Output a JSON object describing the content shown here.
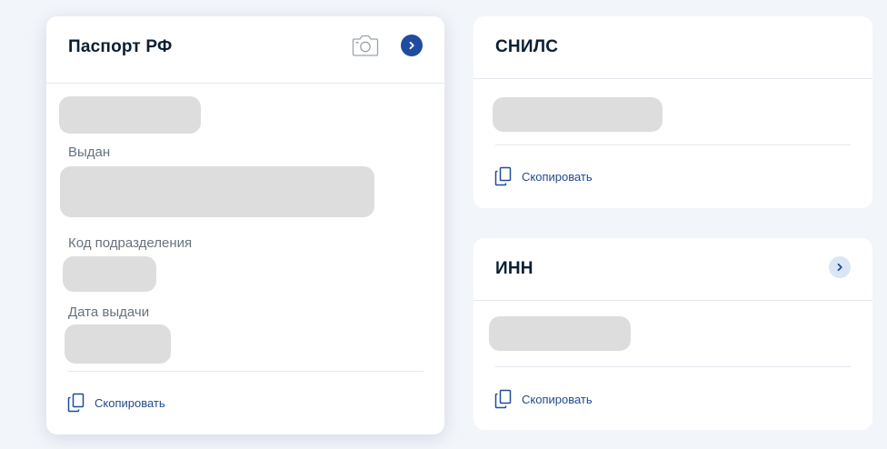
{
  "passport": {
    "title": "Паспорт РФ",
    "fields": {
      "issued_by_label": "Выдан",
      "department_code_label": "Код подразделения",
      "issue_date_label": "Дата выдачи"
    },
    "copy_label": "Скопировать"
  },
  "snils": {
    "title": "СНИЛС",
    "copy_label": "Скопировать"
  },
  "inn": {
    "title": "ИНН",
    "copy_label": "Скопировать"
  },
  "icons": {
    "camera": "camera-icon",
    "chevron": "chevron-right-icon",
    "copy": "copy-icon"
  },
  "colors": {
    "page_background": "#f2f5fa",
    "card_background": "#ffffff",
    "accent": "#1f4ca0",
    "accent_light": "#dbe6f4",
    "link": "#234b8e",
    "masked_value": "#dddddd",
    "label": "#66727f"
  }
}
